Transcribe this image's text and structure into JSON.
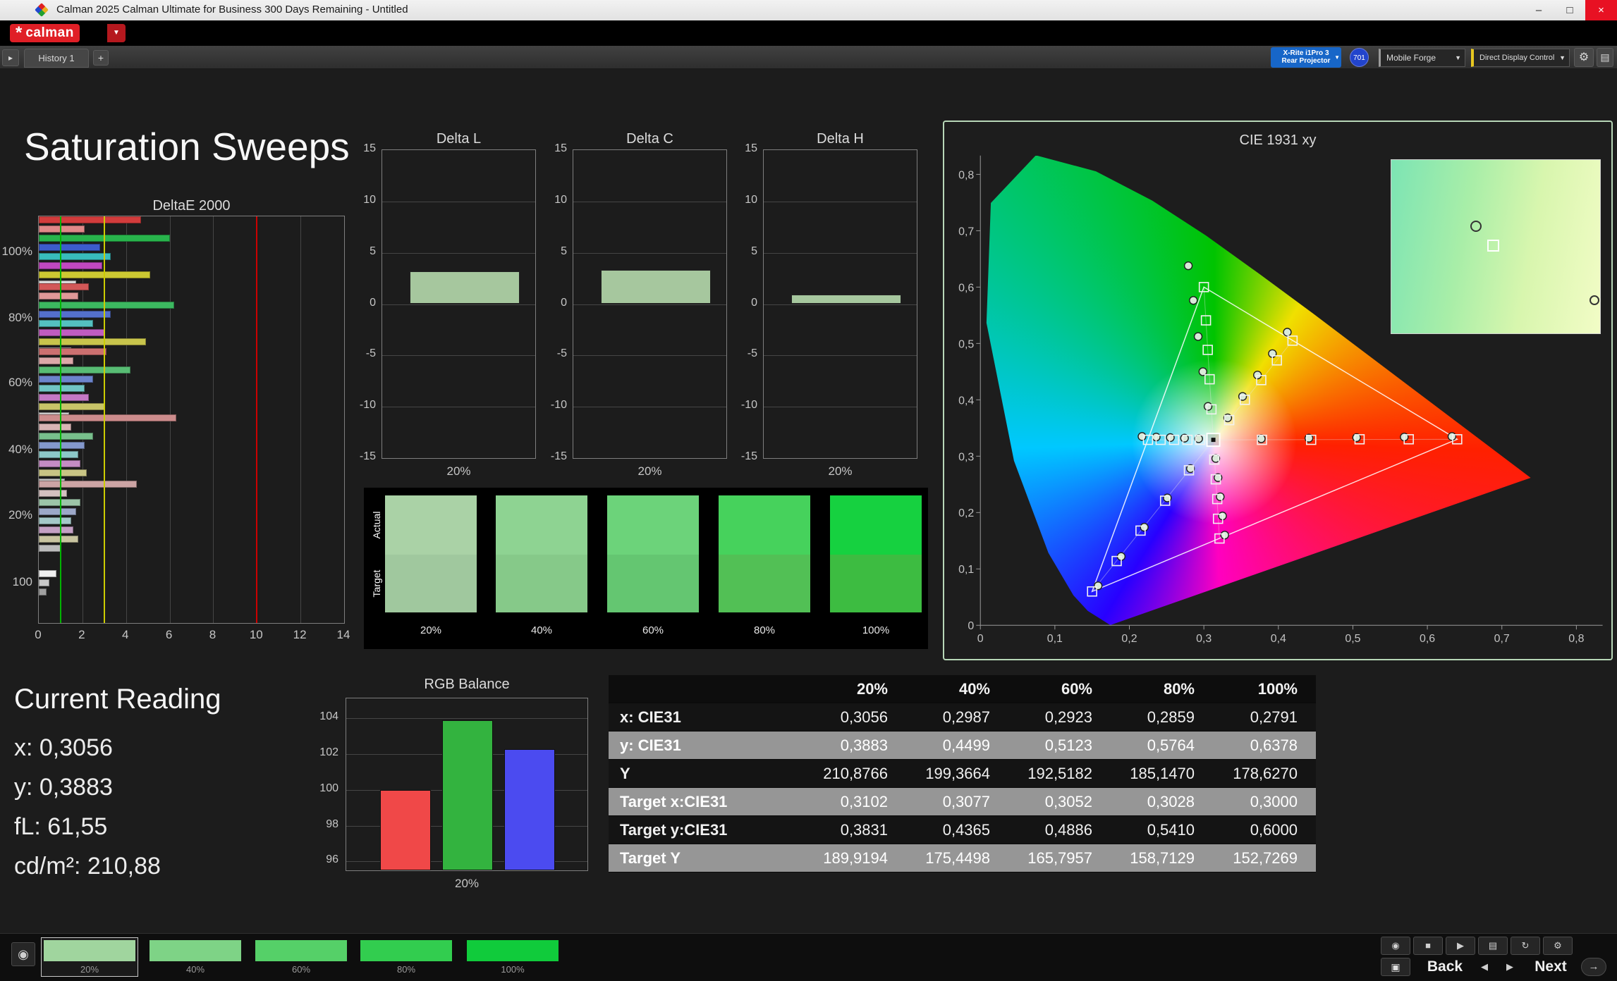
{
  "title_bar": {
    "title": "Calman 2025 Calman Ultimate for Business 300 Days Remaining  - Untitled"
  },
  "icons": {
    "dropdown": "▼",
    "gear": "⚙",
    "panel": "▤",
    "meter": "◉",
    "stop": "■",
    "play": "▶",
    "grid": "▣",
    "refresh": "↻",
    "back_arrow": "◀",
    "forward_arrow": "▶",
    "arrow_right": "→",
    "minimize": "–",
    "maximize": "□",
    "close": "×",
    "plus": "+",
    "toggle": "▸",
    "star": "*"
  },
  "logo": {
    "brand": "calman"
  },
  "toolbar": {
    "history_tab": "History 1",
    "meter_button": {
      "line1": "X-Rite i1Pro 3",
      "line2": "Rear Projector"
    },
    "badge": "701",
    "pattern_source": "Mobile Forge",
    "display_control": "Direct Display Control"
  },
  "page": {
    "title": "Saturation Sweeps"
  },
  "deltae_chart": {
    "type": "bar",
    "title": "DeltaE 2000",
    "x_ticks": [
      0,
      2,
      4,
      6,
      8,
      10,
      12,
      14
    ],
    "x_max": 14,
    "ref_lines": [
      {
        "value": 1,
        "color": "#00b400"
      },
      {
        "value": 3,
        "color": "#cccc00"
      },
      {
        "value": 10,
        "color": "#cc0000"
      }
    ],
    "groups": [
      {
        "label": "100%",
        "bars": [
          [
            "#d23c3c",
            4.7
          ],
          [
            "#e08888",
            2.1
          ],
          [
            "#28b44c",
            6.0
          ],
          [
            "#3c5ccc",
            2.8
          ],
          [
            "#38bcbc",
            3.3
          ],
          [
            "#c048c0",
            2.9
          ],
          [
            "#ccc832",
            5.1
          ],
          [
            "#d8d8d8",
            1.7
          ]
        ]
      },
      {
        "label": "80%",
        "bars": [
          [
            "#d25858",
            2.3
          ],
          [
            "#e09898",
            1.8
          ],
          [
            "#3cb860",
            6.2
          ],
          [
            "#5470cc",
            3.3
          ],
          [
            "#54c0c0",
            2.5
          ],
          [
            "#c05cc0",
            3.0
          ],
          [
            "#c8c44c",
            4.9
          ],
          [
            "#d0d0d0",
            1.5
          ]
        ]
      },
      {
        "label": "60%",
        "bars": [
          [
            "#cc7070",
            3.1
          ],
          [
            "#dca8a8",
            1.6
          ],
          [
            "#58bc74",
            4.2
          ],
          [
            "#6c84cc",
            2.5
          ],
          [
            "#70c4c4",
            2.1
          ],
          [
            "#c478c4",
            2.3
          ],
          [
            "#c8c468",
            3.0
          ],
          [
            "#c8c8c8",
            1.4
          ]
        ]
      },
      {
        "label": "40%",
        "bars": [
          [
            "#cc8c8c",
            6.3
          ],
          [
            "#d8b4b4",
            1.5
          ],
          [
            "#78c08c",
            2.5
          ],
          [
            "#8498cc",
            2.1
          ],
          [
            "#8cc8c8",
            1.8
          ],
          [
            "#c48cc4",
            1.9
          ],
          [
            "#c8c484",
            2.2
          ],
          [
            "#c0c0c0",
            1.2
          ]
        ]
      },
      {
        "label": "20%",
        "bars": [
          [
            "#cca4a4",
            4.5
          ],
          [
            "#d4c0c0",
            1.3
          ],
          [
            "#9cc4a8",
            1.9
          ],
          [
            "#9ca8c8",
            1.7
          ],
          [
            "#a4c8c8",
            1.5
          ],
          [
            "#c4a0c4",
            1.6
          ],
          [
            "#c8c4a0",
            1.8
          ],
          [
            "#bcbcbc",
            1.0
          ]
        ]
      },
      {
        "label": "100",
        "bars": [
          [
            "#f0f0f0",
            0.8
          ],
          [
            "#c8c8c8",
            0.5
          ],
          [
            "#a0a0a0",
            0.35
          ]
        ]
      }
    ]
  },
  "delta_charts": {
    "type": "bar",
    "y_ticks": [
      15,
      10,
      5,
      0,
      -5,
      -10,
      -15
    ],
    "y_range": [
      -15,
      15
    ],
    "x_label": "20%",
    "bar_color": "#a6c79e",
    "charts": [
      {
        "title": "Delta L",
        "value": 3.2
      },
      {
        "title": "Delta C",
        "value": 3.3
      },
      {
        "title": "Delta H",
        "value": 0.9
      }
    ]
  },
  "swatches": {
    "actual_label": "Actual",
    "target_label": "Target",
    "items": [
      {
        "label": "20%",
        "actual": "#aad2a6",
        "target": "#a0c89e"
      },
      {
        "label": "40%",
        "actual": "#8ed392",
        "target": "#86c989"
      },
      {
        "label": "60%",
        "actual": "#6cd37a",
        "target": "#64c671"
      },
      {
        "label": "80%",
        "actual": "#46d25c",
        "target": "#52c055"
      },
      {
        "label": "100%",
        "actual": "#16d140",
        "target": "#3dbc41"
      }
    ]
  },
  "cie": {
    "type": "scatter",
    "title": "CIE 1931 xy",
    "x_ticks": [
      "0",
      "0,1",
      "0,2",
      "0,3",
      "0,4",
      "0,5",
      "0,6",
      "0,7",
      "0,8"
    ],
    "y_ticks": [
      "0",
      "0,1",
      "0,2",
      "0,3",
      "0,4",
      "0,5",
      "0,6",
      "0,7",
      "0,8"
    ],
    "white_point": [
      0.3127,
      0.329
    ],
    "triangle": [
      [
        0.64,
        0.33
      ],
      [
        0.3,
        0.6
      ],
      [
        0.15,
        0.06
      ]
    ],
    "locus": [
      [
        0.1741,
        0.005
      ],
      [
        0.144,
        0.0297
      ],
      [
        0.1241,
        0.0578
      ],
      [
        0.0913,
        0.1327
      ],
      [
        0.0454,
        0.295
      ],
      [
        0.0082,
        0.5384
      ],
      [
        0.0139,
        0.7502
      ],
      [
        0.0743,
        0.8338
      ],
      [
        0.1547,
        0.8059
      ],
      [
        0.2296,
        0.7543
      ],
      [
        0.3016,
        0.6923
      ],
      [
        0.3731,
        0.6245
      ],
      [
        0.4441,
        0.5547
      ],
      [
        0.5125,
        0.4866
      ],
      [
        0.5752,
        0.4242
      ],
      [
        0.627,
        0.3725
      ],
      [
        0.6915,
        0.3083
      ],
      [
        0.7347,
        0.2653
      ]
    ],
    "sweeps": [
      {
        "name": "red",
        "targets": [
          [
            0.378,
            0.329
          ],
          [
            0.444,
            0.329
          ],
          [
            0.509,
            0.33
          ],
          [
            0.575,
            0.33
          ],
          [
            0.64,
            0.33
          ]
        ],
        "measured": [
          [
            0.377,
            0.331
          ],
          [
            0.441,
            0.332
          ],
          [
            0.505,
            0.333
          ],
          [
            0.569,
            0.334
          ],
          [
            0.633,
            0.335
          ]
        ]
      },
      {
        "name": "green",
        "targets": [
          [
            0.3102,
            0.3831
          ],
          [
            0.3077,
            0.4365
          ],
          [
            0.3052,
            0.4886
          ],
          [
            0.3028,
            0.541
          ],
          [
            0.3,
            0.6
          ]
        ],
        "measured": [
          [
            0.3056,
            0.3883
          ],
          [
            0.2987,
            0.4499
          ],
          [
            0.2923,
            0.5123
          ],
          [
            0.2859,
            0.5764
          ],
          [
            0.2791,
            0.6378
          ]
        ]
      },
      {
        "name": "blue",
        "targets": [
          [
            0.28,
            0.275
          ],
          [
            0.248,
            0.221
          ],
          [
            0.215,
            0.168
          ],
          [
            0.183,
            0.114
          ],
          [
            0.15,
            0.06
          ]
        ],
        "measured": [
          [
            0.282,
            0.278
          ],
          [
            0.251,
            0.226
          ],
          [
            0.22,
            0.174
          ],
          [
            0.189,
            0.122
          ],
          [
            0.158,
            0.07
          ]
        ]
      },
      {
        "name": "cyan",
        "targets": [
          [
            0.295,
            0.329
          ],
          [
            0.278,
            0.329
          ],
          [
            0.26,
            0.329
          ],
          [
            0.242,
            0.329
          ],
          [
            0.225,
            0.329
          ]
        ],
        "measured": [
          [
            0.293,
            0.331
          ],
          [
            0.274,
            0.332
          ],
          [
            0.255,
            0.333
          ],
          [
            0.236,
            0.334
          ],
          [
            0.217,
            0.335
          ]
        ]
      },
      {
        "name": "magenta",
        "targets": [
          [
            0.314,
            0.294
          ],
          [
            0.316,
            0.259
          ],
          [
            0.318,
            0.224
          ],
          [
            0.319,
            0.189
          ],
          [
            0.321,
            0.154
          ]
        ],
        "measured": [
          [
            0.316,
            0.296
          ],
          [
            0.319,
            0.262
          ],
          [
            0.322,
            0.228
          ],
          [
            0.325,
            0.194
          ],
          [
            0.328,
            0.16
          ]
        ]
      },
      {
        "name": "yellow",
        "targets": [
          [
            0.334,
            0.364
          ],
          [
            0.355,
            0.4
          ],
          [
            0.377,
            0.435
          ],
          [
            0.398,
            0.47
          ],
          [
            0.419,
            0.505
          ]
        ],
        "measured": [
          [
            0.332,
            0.368
          ],
          [
            0.352,
            0.406
          ],
          [
            0.372,
            0.444
          ],
          [
            0.392,
            0.482
          ],
          [
            0.412,
            0.52
          ]
        ]
      }
    ]
  },
  "current_reading": {
    "title": "Current Reading",
    "lines": [
      "x: 0,3056",
      "y: 0,3883",
      "fL: 61,55",
      "cd/m²: 210,88"
    ]
  },
  "rgb_balance": {
    "type": "bar",
    "title": "RGB Balance",
    "y_ticks": [
      104,
      102,
      100,
      98,
      96
    ],
    "y_min": 95.5,
    "y_max": 105.2,
    "x_label": "20%",
    "bars": [
      {
        "name": "red",
        "color": "#f04848",
        "value": 100.0
      },
      {
        "name": "green",
        "color": "#33b33f",
        "value": 103.9
      },
      {
        "name": "blue",
        "color": "#4b4bf0",
        "value": 102.3
      }
    ]
  },
  "table": {
    "header": [
      "",
      "20%",
      "40%",
      "60%",
      "80%",
      "100%"
    ],
    "rows": [
      {
        "label": "x: CIE31",
        "shade": "dark",
        "values": [
          "0,3056",
          "0,2987",
          "0,2923",
          "0,2859",
          "0,2791"
        ]
      },
      {
        "label": "y: CIE31",
        "shade": "light",
        "values": [
          "0,3883",
          "0,4499",
          "0,5123",
          "0,5764",
          "0,6378"
        ]
      },
      {
        "label": "Y",
        "shade": "dark",
        "values": [
          "210,8766",
          "199,3664",
          "192,5182",
          "185,1470",
          "178,6270"
        ]
      },
      {
        "label": "Target x:CIE31",
        "shade": "light",
        "values": [
          "0,3102",
          "0,3077",
          "0,3052",
          "0,3028",
          "0,3000"
        ]
      },
      {
        "label": "Target y:CIE31",
        "shade": "dark",
        "values": [
          "0,3831",
          "0,4365",
          "0,4886",
          "0,5410",
          "0,6000"
        ]
      },
      {
        "label": "Target Y",
        "shade": "light",
        "values": [
          "189,9194",
          "175,4498",
          "165,7957",
          "158,7129",
          "152,7269"
        ]
      }
    ]
  },
  "bottom_bar": {
    "swatches": [
      {
        "label": "20%",
        "color": "#a0d59e",
        "selected": true
      },
      {
        "label": "40%",
        "color": "#7ed386",
        "selected": false
      },
      {
        "label": "60%",
        "color": "#55d068",
        "selected": false
      },
      {
        "label": "80%",
        "color": "#32cd4f",
        "selected": false
      },
      {
        "label": "100%",
        "color": "#10cb3b",
        "selected": false
      }
    ],
    "back_label": "Back",
    "next_label": "Next"
  }
}
